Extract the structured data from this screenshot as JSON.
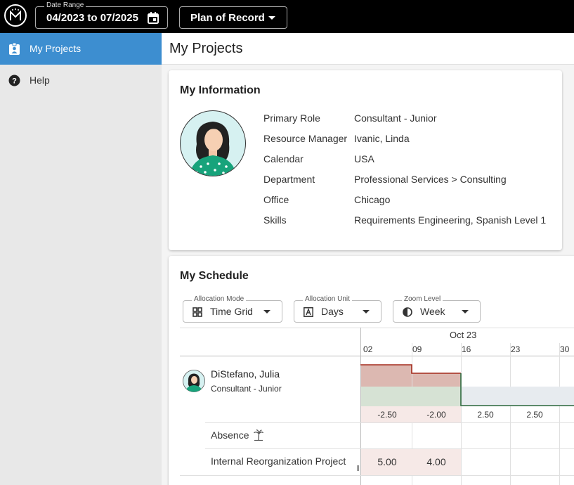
{
  "topbar": {
    "logo_icon": "m-logo-icon",
    "date_range_legend": "Date Range",
    "date_range_value": "04/2023 to 07/2025",
    "calendar_icon": "calendar-icon",
    "plan_value": "Plan of Record"
  },
  "sidebar": {
    "items": [
      {
        "label": "My Projects",
        "icon": "badge-icon",
        "active": true
      },
      {
        "label": "Help",
        "icon": "help-circle-icon",
        "active": false
      }
    ]
  },
  "page": {
    "title": "My Projects"
  },
  "info": {
    "title": "My Information",
    "fields": [
      {
        "label": "Primary Role",
        "value": "Consultant - Junior"
      },
      {
        "label": "Resource Manager",
        "value": "Ivanic, Linda"
      },
      {
        "label": "Calendar",
        "value": "USA"
      },
      {
        "label": "Department",
        "value": "Professional Services > Consulting"
      },
      {
        "label": "Office",
        "value": "Chicago"
      },
      {
        "label": "Skills",
        "value": "Requirements Engineering, Spanish Level 1"
      }
    ]
  },
  "schedule": {
    "title": "My Schedule",
    "allocation_mode": {
      "legend": "Allocation Mode",
      "value": "Time Grid",
      "icon": "grid-icon"
    },
    "allocation_unit": {
      "legend": "Allocation Unit",
      "value": "Days",
      "icon": "letter-a-icon"
    },
    "zoom_level": {
      "legend": "Zoom Level",
      "value": "Week",
      "icon": "half-circle-icon"
    },
    "month": "Oct 23",
    "weeks": [
      "02",
      "09",
      "16",
      "23",
      "30"
    ],
    "person": {
      "name": "DiStefano, Julia",
      "role": "Consultant - Junior"
    },
    "availability": [
      "-2.50",
      "-2.00",
      "2.50",
      "2.50"
    ],
    "rows": [
      {
        "label": "Absence",
        "icon": "palm-tree-icon",
        "values": []
      },
      {
        "label": "Internal Reorganization Project",
        "values": [
          "5.00",
          "4.00"
        ]
      }
    ]
  },
  "colors": {
    "accent": "#3d8ed0",
    "overalloc": "#a32a1c",
    "available": "#2e6b3f"
  }
}
